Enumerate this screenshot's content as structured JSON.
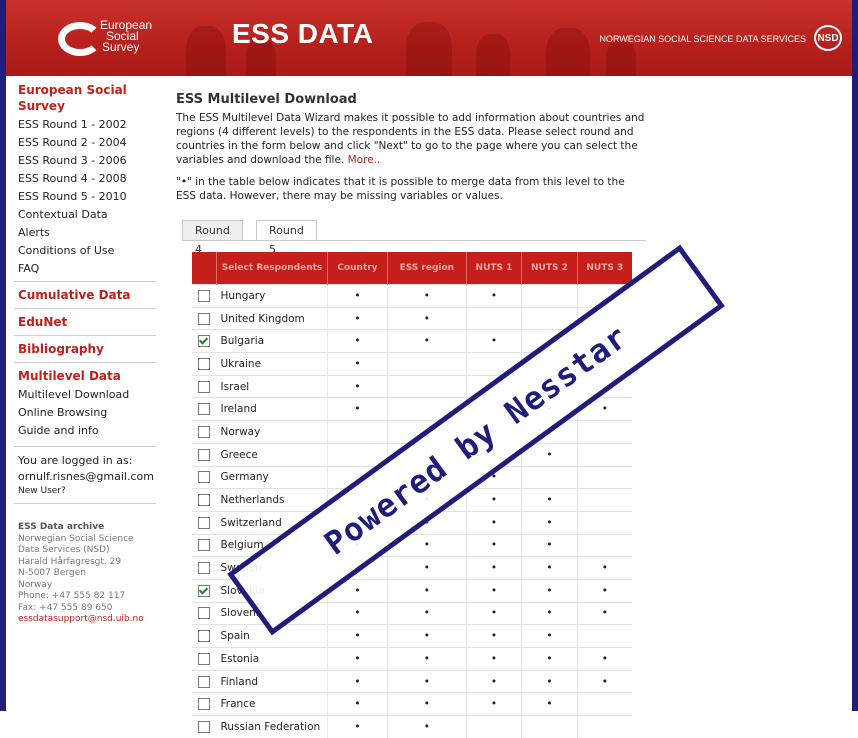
{
  "header": {
    "logo_line1": "European",
    "logo_line2": "Social",
    "logo_line3": "Survey",
    "title": "ESS DATA",
    "org": "NORWEGIAN SOCIAL SCIENCE DATA SERVICES",
    "badge": "NSD"
  },
  "sidebar": {
    "ess_head": "European Social Survey",
    "rounds": [
      "ESS Round 1 - 2002",
      "ESS Round 2 - 2004",
      "ESS Round 3 - 2006",
      "ESS Round 4 - 2008",
      "ESS Round 5 - 2010",
      "Contextual Data",
      "Alerts",
      "Conditions of Use",
      "FAQ"
    ],
    "cumulative": "Cumulative Data",
    "edunet": "EduNet",
    "bibliography": "Bibliography",
    "multilevel_head": "Multilevel Data",
    "multilevel_items": [
      "Multilevel Download",
      "Online Browsing",
      "Guide and info"
    ],
    "login_label": "You are logged in as:",
    "login_user": "ornulf.risnes@gmail.com",
    "new_user": "New User?",
    "archive_title": "ESS Data archive",
    "archive_lines": [
      "Norwegian Social Science",
      "Data Services (NSD)",
      "Harald Hårfagresgt. 29",
      "N-5007 Bergen",
      "Norway",
      "Phone: +47 555 82 117",
      "Fax: +47 555 89 650"
    ],
    "archive_email": "essdatasupport@nsd.uib.no"
  },
  "main": {
    "title": "ESS Multilevel Download",
    "intro": "The ESS Multilevel Data Wizard makes it possible to add information about countries and regions (4 different levels) to the respondents in the ESS data. Please select round and countries in the form below and click \"Next\" to go to the page where you can select the variables and download the file.",
    "more": "More..",
    "note": "\"•\" in the table below indicates that it is possible to merge data from this level to the ESS data. However, there may be missing variables or values.",
    "tabs": [
      "Round 4",
      "Round 5"
    ]
  },
  "table": {
    "headers": [
      "Select Respondents",
      "Country",
      "ESS region",
      "NUTS 1",
      "NUTS 2",
      "NUTS 3"
    ],
    "rows": [
      {
        "name": "Hungary",
        "checked": false,
        "dots": [
          "•",
          "•",
          "•",
          "",
          ""
        ]
      },
      {
        "name": "United Kingdom",
        "checked": false,
        "dots": [
          "•",
          "•",
          "",
          "",
          ""
        ]
      },
      {
        "name": "Bulgaria",
        "checked": true,
        "dots": [
          "•",
          "•",
          "•",
          "",
          "•"
        ]
      },
      {
        "name": "Ukraine",
        "checked": false,
        "dots": [
          "•",
          "",
          "",
          "",
          ""
        ]
      },
      {
        "name": "Israel",
        "checked": false,
        "dots": [
          "•",
          "",
          "",
          "",
          ""
        ]
      },
      {
        "name": "Ireland",
        "checked": false,
        "dots": [
          "•",
          "",
          "",
          "•",
          "•"
        ]
      },
      {
        "name": "Norway",
        "checked": false,
        "dots": [
          "",
          "",
          "•",
          "•",
          ""
        ]
      },
      {
        "name": "Greece",
        "checked": false,
        "dots": [
          "",
          "",
          "•",
          "•",
          ""
        ]
      },
      {
        "name": "Germany",
        "checked": false,
        "dots": [
          "",
          "•",
          "•",
          "",
          ""
        ]
      },
      {
        "name": "Netherlands",
        "checked": false,
        "dots": [
          "",
          "•",
          "•",
          "•",
          ""
        ]
      },
      {
        "name": "Switzerland",
        "checked": false,
        "dots": [
          "",
          "•",
          "•",
          "•",
          ""
        ]
      },
      {
        "name": "Belgium",
        "checked": false,
        "dots": [
          "•",
          "•",
          "•",
          "•",
          ""
        ]
      },
      {
        "name": "Sweden",
        "checked": false,
        "dots": [
          "•",
          "•",
          "•",
          "•",
          "•"
        ]
      },
      {
        "name": "Slovakia",
        "checked": true,
        "dots": [
          "•",
          "•",
          "•",
          "•",
          "•"
        ]
      },
      {
        "name": "Slovenia",
        "checked": false,
        "dots": [
          "•",
          "•",
          "•",
          "•",
          "•"
        ]
      },
      {
        "name": "Spain",
        "checked": false,
        "dots": [
          "•",
          "•",
          "•",
          "•",
          ""
        ]
      },
      {
        "name": "Estonia",
        "checked": false,
        "dots": [
          "•",
          "•",
          "•",
          "•",
          "•"
        ]
      },
      {
        "name": "Finland",
        "checked": false,
        "dots": [
          "•",
          "•",
          "•",
          "•",
          "•"
        ]
      },
      {
        "name": "France",
        "checked": false,
        "dots": [
          "•",
          "•",
          "•",
          "•",
          ""
        ]
      },
      {
        "name": "Russian Federation",
        "checked": false,
        "dots": [
          "•",
          "•",
          "",
          "",
          ""
        ]
      }
    ]
  },
  "watermark": "Powered by Nesstar",
  "colors": {
    "brand_red": "#c61f1b",
    "frame_navy": "#1f1d7a"
  }
}
